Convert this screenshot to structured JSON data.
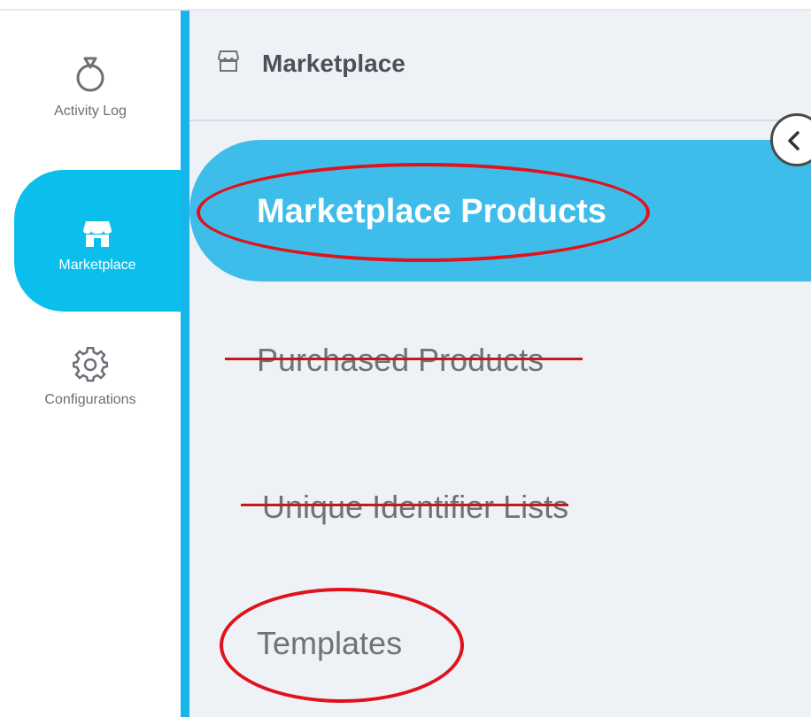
{
  "rail": {
    "items": [
      {
        "label": "Activity Log",
        "icon": "stopwatch-icon"
      },
      {
        "label": "Marketplace",
        "icon": "store-icon"
      },
      {
        "label": "Configurations",
        "icon": "gear-icon"
      }
    ]
  },
  "panel": {
    "title": "Marketplace",
    "title_icon": "store-icon",
    "items": [
      {
        "label": "Marketplace Products",
        "state": "active"
      },
      {
        "label": "Purchased Products",
        "state": "struck-through"
      },
      {
        "label": "Unique Identifier Lists",
        "state": "struck-through"
      },
      {
        "label": "Templates",
        "state": "normal"
      }
    ]
  },
  "colors": {
    "accent": "#0bbfed",
    "active_bg": "#3ebdeb",
    "annotation_red": "#e0121b"
  }
}
